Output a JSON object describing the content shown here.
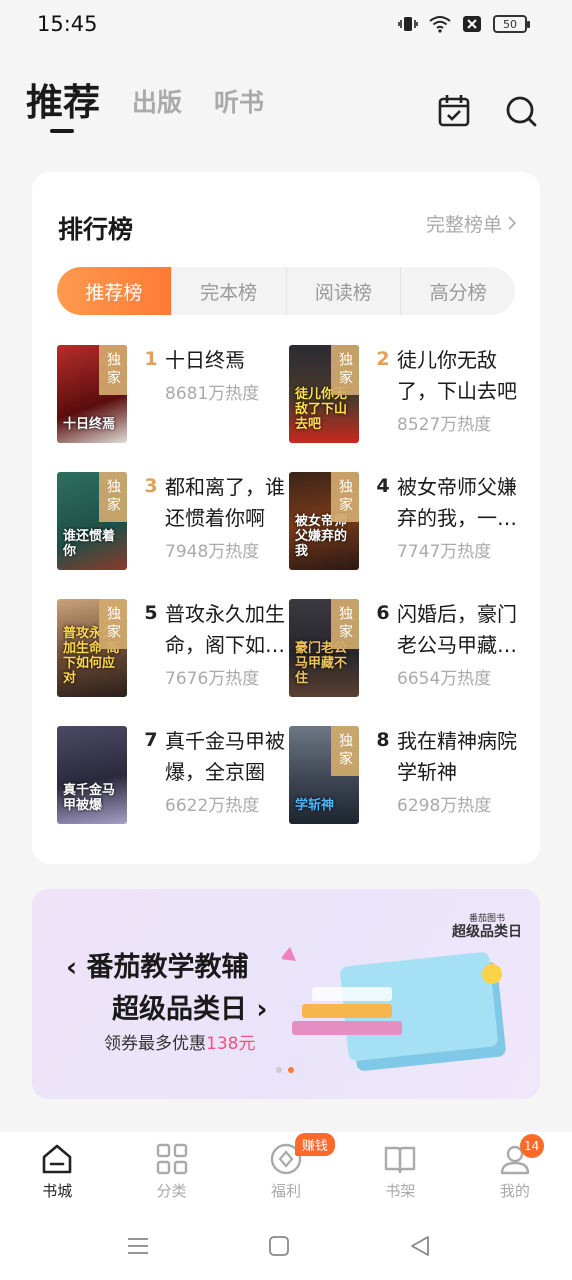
{
  "status": {
    "time": "15:45",
    "battery": "50"
  },
  "top_tabs": [
    {
      "label": "推荐",
      "active": true
    },
    {
      "label": "出版",
      "active": false
    },
    {
      "label": "听书",
      "active": false
    }
  ],
  "ranking": {
    "title": "排行榜",
    "more": "完整榜单",
    "segments": [
      "推荐榜",
      "完本榜",
      "阅读榜",
      "高分榜"
    ],
    "exclusive_tag": "独家",
    "books": [
      {
        "rank": "1",
        "title": "十日终焉",
        "heat": "8681万热度",
        "cover_text": "十日终焉"
      },
      {
        "rank": "2",
        "title": "徒儿你无敌了，下山去吧",
        "heat": "8527万热度",
        "cover_text": "徒儿你无敌了下山去吧"
      },
      {
        "rank": "3",
        "title": "都和离了，谁还惯着你啊",
        "heat": "7948万热度",
        "cover_text": "谁还惯着你"
      },
      {
        "rank": "4",
        "title": "被女帝师父嫌弃的我，一怒之下",
        "heat": "7747万热度",
        "cover_text": "被女帝师父嫌弃的我"
      },
      {
        "rank": "5",
        "title": "普攻永久加生命，阁下如何应对",
        "heat": "7676万热度",
        "cover_text": "普攻永久加生命 阁下如何应对"
      },
      {
        "rank": "6",
        "title": "闪婚后，豪门老公马甲藏不住",
        "heat": "6654万热度",
        "cover_text": "豪门老公马甲藏不住"
      },
      {
        "rank": "7",
        "title": "真千金马甲被爆，全京圈",
        "heat": "6622万热度",
        "cover_text": "真千金马甲被爆"
      },
      {
        "rank": "8",
        "title": "我在精神病院学斩神",
        "heat": "6298万热度",
        "cover_text": "学斩神"
      }
    ]
  },
  "banner": {
    "line1": "番茄教学教辅",
    "line2": "超级品类日",
    "line3_prefix": "领券最多优惠",
    "line3_highlight": "138元",
    "badge_small": "番茄图书",
    "badge_main": "超级品类日"
  },
  "bottom_nav": [
    {
      "label": "书城",
      "icon": "home-icon",
      "active": true
    },
    {
      "label": "分类",
      "icon": "grid-icon",
      "active": false
    },
    {
      "label": "福利",
      "icon": "coin-icon",
      "active": false,
      "badge": "赚钱"
    },
    {
      "label": "书架",
      "icon": "book-icon",
      "active": false
    },
    {
      "label": "我的",
      "icon": "user-icon",
      "active": false,
      "badge": "14"
    }
  ],
  "colors": {
    "accent": "#ff7a35",
    "rank_gold": "#e0a25a"
  }
}
